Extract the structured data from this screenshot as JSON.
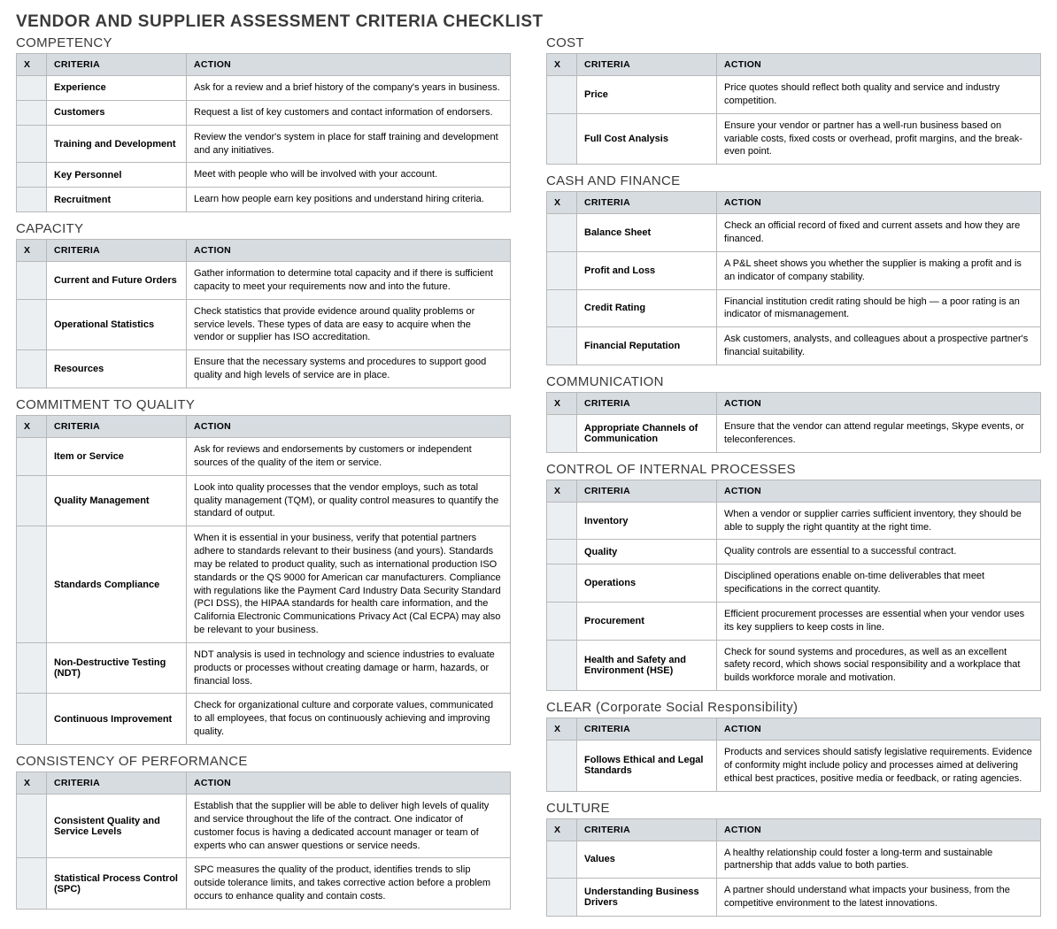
{
  "title": "VENDOR AND SUPPLIER ASSESSMENT CRITERIA CHECKLIST",
  "headers": {
    "x": "X",
    "criteria": "CRITERIA",
    "action": "ACTION"
  },
  "left": [
    {
      "name": "competency",
      "title": "COMPETENCY",
      "rows": [
        {
          "criteria": "Experience",
          "action": "Ask for a review and a brief history of the company's years in business."
        },
        {
          "criteria": "Customers",
          "action": "Request a list of key customers and contact information of endorsers."
        },
        {
          "criteria": "Training and Development",
          "action": "Review the vendor's system in place for staff training and development and any initiatives."
        },
        {
          "criteria": "Key Personnel",
          "action": "Meet with people who will be involved with your account."
        },
        {
          "criteria": "Recruitment",
          "action": "Learn how people earn key positions and understand hiring criteria."
        }
      ]
    },
    {
      "name": "capacity",
      "title": "CAPACITY",
      "rows": [
        {
          "criteria": "Current and Future Orders",
          "action": "Gather information to determine total capacity and if there is sufficient capacity to meet your requirements now and into the future."
        },
        {
          "criteria": "Operational Statistics",
          "action": "Check statistics that provide evidence around quality problems or service levels. These types of data are easy to acquire when the vendor or supplier has ISO accreditation."
        },
        {
          "criteria": "Resources",
          "action": "Ensure that the necessary systems and procedures to support good quality and high levels of service are in place."
        }
      ]
    },
    {
      "name": "commitment-to-quality",
      "title": "COMMITMENT TO QUALITY",
      "rows": [
        {
          "criteria": "Item or Service",
          "action": "Ask for reviews and endorsements by customers or independent sources of the quality of the item or service."
        },
        {
          "criteria": "Quality Management",
          "action": "Look into quality processes that the vendor employs, such as total quality management (TQM), or quality control measures to quantify the standard of output."
        },
        {
          "criteria": "Standards Compliance",
          "action": "When it is essential in your business, verify that potential partners adhere to standards relevant to their business (and yours). Standards may be related to product quality, such as international production ISO standards or the QS 9000 for American car manufacturers. Compliance with regulations like the Payment Card Industry Data Security Standard (PCI DSS), the HIPAA standards for health care information, and the California Electronic Communications Privacy Act (Cal ECPA) may also be relevant to your business."
        },
        {
          "criteria": "Non-Destructive Testing (NDT)",
          "action": "NDT analysis is used in technology and science industries to evaluate products or processes without creating damage or harm, hazards, or financial loss."
        },
        {
          "criteria": "Continuous Improvement",
          "action": "Check for organizational culture and corporate values, communicated to all employees, that focus on continuously achieving and improving quality."
        }
      ]
    },
    {
      "name": "consistency-of-performance",
      "title": "CONSISTENCY OF PERFORMANCE",
      "rows": [
        {
          "criteria": "Consistent Quality and Service Levels",
          "action": "Establish that the supplier will be able to deliver high levels of quality and service throughout the life of the contract. One indicator of customer focus is having a dedicated account manager or team of experts who can answer questions or service needs."
        },
        {
          "criteria": "Statistical Process Control (SPC)",
          "action": "SPC measures the quality of the product, identifies trends to slip outside tolerance limits, and takes corrective action before a problem occurs to enhance quality and contain costs."
        }
      ]
    }
  ],
  "right": [
    {
      "name": "cost",
      "title": "COST",
      "rows": [
        {
          "criteria": "Price",
          "action": "Price quotes should reflect both quality and service and industry competition."
        },
        {
          "criteria": "Full Cost Analysis",
          "action": "Ensure your vendor or partner has a well-run business based on variable costs, fixed costs or overhead, profit margins, and the break-even point."
        }
      ]
    },
    {
      "name": "cash-and-finance",
      "title": "CASH AND FINANCE",
      "rows": [
        {
          "criteria": "Balance Sheet",
          "action": "Check an official record of fixed and current assets and how they are financed."
        },
        {
          "criteria": "Profit and Loss",
          "action": "A P&L sheet shows you whether the supplier is making a profit and is an indicator of company stability."
        },
        {
          "criteria": "Credit Rating",
          "action": "Financial institution credit rating should be high — a poor rating is an indicator of mismanagement."
        },
        {
          "criteria": "Financial Reputation",
          "action": "Ask customers, analysts, and colleagues about a prospective partner's financial suitability."
        }
      ]
    },
    {
      "name": "communication",
      "title": "COMMUNICATION",
      "rows": [
        {
          "criteria": "Appropriate Channels of Communication",
          "action": "Ensure that the vendor can attend regular meetings, Skype events, or teleconferences."
        }
      ]
    },
    {
      "name": "control-of-internal-processes",
      "title": "CONTROL OF INTERNAL PROCESSES",
      "rows": [
        {
          "criteria": "Inventory",
          "action": "When a vendor or supplier carries sufficient inventory, they should be able to supply the right quantity at the right time."
        },
        {
          "criteria": "Quality",
          "action": "Quality controls are essential to a successful contract."
        },
        {
          "criteria": "Operations",
          "action": "Disciplined operations enable on-time deliverables that meet specifications in the correct quantity."
        },
        {
          "criteria": "Procurement",
          "action": "Efficient procurement processes are essential when your vendor uses its key suppliers to keep costs in line."
        },
        {
          "criteria": "Health and Safety and Environment (HSE)",
          "action": "Check for sound systems and procedures, as well as an excellent safety record, which shows social responsibility and a workplace that builds workforce morale and motivation."
        }
      ]
    },
    {
      "name": "clear",
      "title": "CLEAR (Corporate Social Responsibility)",
      "rows": [
        {
          "criteria": "Follows Ethical and Legal Standards",
          "action": "Products and services should satisfy legislative requirements. Evidence of conformity might include policy and processes aimed at delivering ethical best practices, positive media or feedback, or rating agencies."
        }
      ]
    },
    {
      "name": "culture",
      "title": "CULTURE",
      "rows": [
        {
          "criteria": "Values",
          "action": "A healthy relationship could foster a long-term and sustainable partnership that adds value to both parties."
        },
        {
          "criteria": "Understanding Business Drivers",
          "action": "A partner should understand what impacts your business, from the competitive environment to the latest innovations."
        }
      ]
    }
  ]
}
